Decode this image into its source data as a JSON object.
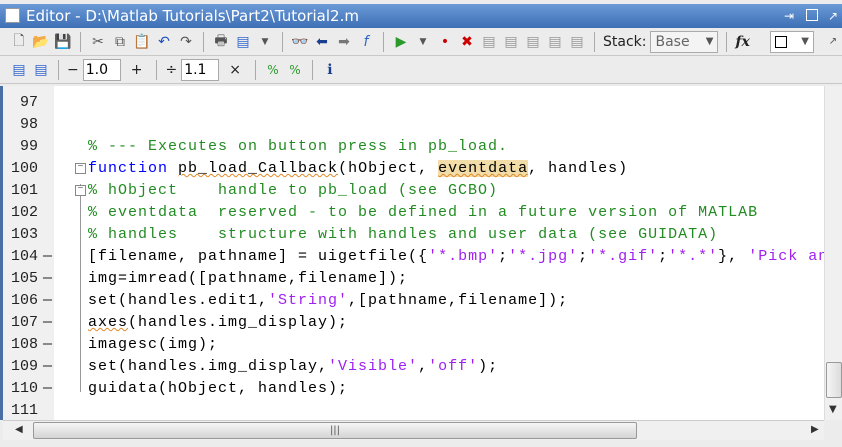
{
  "window": {
    "title": "Editor - D:\\Matlab Tutorials\\Part2\\Tutorial2.m"
  },
  "toolbar": {
    "stack_label": "Stack:",
    "stack_value": "Base",
    "fx_label": "fx"
  },
  "cell_toolbar": {
    "minus": "−",
    "value1": "1.0",
    "plus": "+",
    "divide": "÷",
    "value2": "1.1",
    "times": "×"
  },
  "code": {
    "lines": [
      {
        "n": "97",
        "bp": "",
        "fold": "",
        "parts": []
      },
      {
        "n": "98",
        "bp": "",
        "fold": "",
        "parts": []
      },
      {
        "n": "99",
        "bp": "",
        "fold": "",
        "parts": [
          {
            "c": "cm",
            "t": "% --- Executes on button press in pb_load."
          }
        ]
      },
      {
        "n": "100",
        "bp": "",
        "fold": "−",
        "parts": [
          {
            "c": "kw",
            "t": "function"
          },
          {
            "c": "tx",
            "t": " "
          },
          {
            "c": "tx sq",
            "t": "pb_load_Callback"
          },
          {
            "c": "tx",
            "t": "(hObject, "
          },
          {
            "c": "tx hl sq",
            "t": "eventdata"
          },
          {
            "c": "tx",
            "t": ", handles)"
          }
        ]
      },
      {
        "n": "101",
        "bp": "",
        "fold": "−",
        "parts": [
          {
            "c": "cm",
            "t": "% hObject    handle to pb_load (see GCBO)"
          }
        ]
      },
      {
        "n": "102",
        "bp": "",
        "fold": "",
        "parts": [
          {
            "c": "cm",
            "t": "% eventdata  reserved - to be defined in a future version of MATLAB"
          }
        ]
      },
      {
        "n": "103",
        "bp": "",
        "fold": "",
        "parts": [
          {
            "c": "cm",
            "t": "% handles    structure with handles and user data (see GUIDATA)"
          }
        ]
      },
      {
        "n": "104",
        "bp": "—",
        "fold": "",
        "parts": [
          {
            "c": "tx",
            "t": "[filename, pathname] = uigetfile({"
          },
          {
            "c": "st",
            "t": "'*.bmp'"
          },
          {
            "c": "tx",
            "t": ";"
          },
          {
            "c": "st",
            "t": "'*.jpg'"
          },
          {
            "c": "tx",
            "t": ";"
          },
          {
            "c": "st",
            "t": "'*.gif'"
          },
          {
            "c": "tx",
            "t": ";"
          },
          {
            "c": "st",
            "t": "'*.*'"
          },
          {
            "c": "tx",
            "t": "}, "
          },
          {
            "c": "st",
            "t": "'Pick an"
          }
        ]
      },
      {
        "n": "105",
        "bp": "—",
        "fold": "",
        "parts": [
          {
            "c": "tx",
            "t": "img=imread([pathname,filename]);"
          }
        ]
      },
      {
        "n": "106",
        "bp": "—",
        "fold": "",
        "parts": [
          {
            "c": "tx",
            "t": "set(handles.edit1,"
          },
          {
            "c": "st",
            "t": "'String'"
          },
          {
            "c": "tx",
            "t": ",[pathname,filename]);"
          }
        ]
      },
      {
        "n": "107",
        "bp": "—",
        "fold": "",
        "parts": [
          {
            "c": "tx sq",
            "t": "axes"
          },
          {
            "c": "tx",
            "t": "(handles.img_display);"
          }
        ]
      },
      {
        "n": "108",
        "bp": "—",
        "fold": "",
        "parts": [
          {
            "c": "tx",
            "t": "imagesc(img);"
          }
        ]
      },
      {
        "n": "109",
        "bp": "—",
        "fold": "",
        "parts": [
          {
            "c": "tx",
            "t": "set(handles.img_display,"
          },
          {
            "c": "st",
            "t": "'Visible'"
          },
          {
            "c": "tx",
            "t": ","
          },
          {
            "c": "st",
            "t": "'off'"
          },
          {
            "c": "tx",
            "t": ");"
          }
        ]
      },
      {
        "n": "110",
        "bp": "—",
        "fold": "",
        "parts": [
          {
            "c": "tx",
            "t": "guidata(hObject, handles);"
          }
        ]
      },
      {
        "n": "111",
        "bp": "",
        "fold": "",
        "parts": []
      }
    ]
  }
}
